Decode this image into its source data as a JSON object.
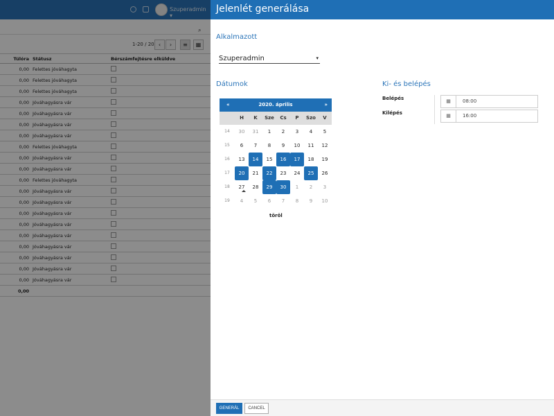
{
  "background": {
    "user_name": "Szuperadmin ▾",
    "pager_text": "1-20 / 20",
    "prev_glyph": "‹",
    "next_glyph": "›",
    "columns": [
      "Túlóra",
      "Státusz",
      "Bérszámfejtésre elküldve"
    ],
    "rows": [
      [
        "0,00",
        "Felettes jóváhagyta"
      ],
      [
        "0,00",
        "Felettes jóváhagyta"
      ],
      [
        "0,00",
        "Felettes jóváhagyta"
      ],
      [
        "0,00",
        "Jóváhagyásra vár"
      ],
      [
        "0,00",
        "Jóváhagyásra vár"
      ],
      [
        "0,00",
        "Jóváhagyásra vár"
      ],
      [
        "0,00",
        "Jóváhagyásra vár"
      ],
      [
        "0,00",
        "Felettes jóváhagyta"
      ],
      [
        "0,00",
        "Jóváhagyásra vár"
      ],
      [
        "0,00",
        "Jóváhagyásra vár"
      ],
      [
        "0,00",
        "Felettes jóváhagyta"
      ],
      [
        "0,00",
        "Jóváhagyásra vár"
      ],
      [
        "0,00",
        "Jóváhagyásra vár"
      ],
      [
        "0,00",
        "Jóváhagyásra vár"
      ],
      [
        "0,00",
        "Jóváhagyásra vár"
      ],
      [
        "0,00",
        "Jóváhagyásra vár"
      ],
      [
        "0,00",
        "Jóváhagyásra vár"
      ],
      [
        "0,00",
        "Jóváhagyásra vár"
      ],
      [
        "0,00",
        "Jóváhagyásra vár"
      ],
      [
        "0,00",
        "Jóváhagyásra vár"
      ]
    ],
    "total": "0,00"
  },
  "panel": {
    "title": "Jelenlét generálása",
    "employee_label": "Alkalmazott",
    "employee_value": "Szuperadmin",
    "dates_label": "Dátumok",
    "inout_label": "Ki- és belépés",
    "entry_label": "Belépés",
    "entry_value": "08:00",
    "exit_label": "Kilépés",
    "exit_value": "16:00",
    "generate_button": "GENERÁL",
    "cancel_button": "CANCEL"
  },
  "calendar": {
    "title": "2020. április",
    "prev": "«",
    "next": "»",
    "weekdays": [
      "H",
      "K",
      "Sze",
      "Cs",
      "P",
      "Szo",
      "V"
    ],
    "clear": "töröl",
    "weeks": [
      {
        "wk": "14",
        "days": [
          {
            "d": "30",
            "o": true
          },
          {
            "d": "31",
            "o": true
          },
          {
            "d": "1"
          },
          {
            "d": "2"
          },
          {
            "d": "3"
          },
          {
            "d": "4"
          },
          {
            "d": "5"
          }
        ]
      },
      {
        "wk": "15",
        "days": [
          {
            "d": "6"
          },
          {
            "d": "7"
          },
          {
            "d": "8"
          },
          {
            "d": "9"
          },
          {
            "d": "10"
          },
          {
            "d": "11"
          },
          {
            "d": "12"
          }
        ]
      },
      {
        "wk": "16",
        "days": [
          {
            "d": "13"
          },
          {
            "d": "14",
            "s": true
          },
          {
            "d": "15"
          },
          {
            "d": "16",
            "s": true
          },
          {
            "d": "17",
            "s": true
          },
          {
            "d": "18"
          },
          {
            "d": "19"
          }
        ]
      },
      {
        "wk": "17",
        "days": [
          {
            "d": "20",
            "s": true
          },
          {
            "d": "21"
          },
          {
            "d": "22",
            "s": true
          },
          {
            "d": "23"
          },
          {
            "d": "24"
          },
          {
            "d": "25",
            "s": true
          },
          {
            "d": "26"
          }
        ]
      },
      {
        "wk": "18",
        "days": [
          {
            "d": "27",
            "t": true
          },
          {
            "d": "28"
          },
          {
            "d": "29",
            "s": true
          },
          {
            "d": "30",
            "s": true
          },
          {
            "d": "1",
            "o": true
          },
          {
            "d": "2",
            "o": true
          },
          {
            "d": "3",
            "o": true
          }
        ]
      },
      {
        "wk": "19",
        "days": [
          {
            "d": "4",
            "o": true
          },
          {
            "d": "5",
            "o": true
          },
          {
            "d": "6",
            "o": true
          },
          {
            "d": "7",
            "o": true
          },
          {
            "d": "8",
            "o": true
          },
          {
            "d": "9",
            "o": true
          },
          {
            "d": "10",
            "o": true
          }
        ]
      }
    ]
  }
}
